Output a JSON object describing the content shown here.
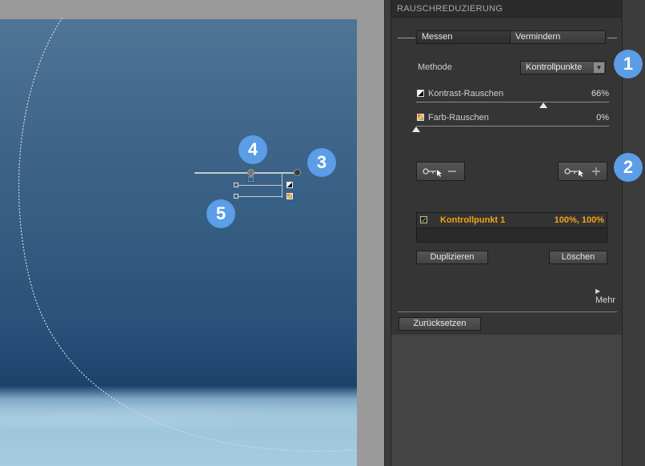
{
  "panel": {
    "title": "RAUSCHREDUZIERUNG",
    "tabs": [
      {
        "label": "Messen"
      },
      {
        "label": "Vermindern"
      }
    ],
    "method": {
      "label": "Methode",
      "value": "Kontrollpunkte"
    },
    "sliders": [
      {
        "label": "Kontrast-Rauschen",
        "value": "66%",
        "level": 0.66
      },
      {
        "label": "Farb-Rauschen",
        "value": "0%",
        "level": 0.0
      }
    ],
    "control_points": [
      {
        "label": "Kontrollpunkt 1",
        "value": "100%, 100%",
        "checked": true
      }
    ],
    "buttons": {
      "duplicate": "Duplizieren",
      "delete": "Löschen",
      "more": "Mehr",
      "reset": "Zurücksetzen"
    }
  },
  "badges": [
    "1",
    "2",
    "3",
    "4",
    "5"
  ],
  "colors": {
    "accent_badge": "#5b9de6",
    "control_point_text": "#f2a418",
    "panel_bg": "#353535"
  },
  "icons": {
    "remove_point": "key-minus-icon",
    "add_point": "key-plus-icon",
    "dropdown": "triangle-down-icon",
    "more": "triangle-right-icon"
  }
}
